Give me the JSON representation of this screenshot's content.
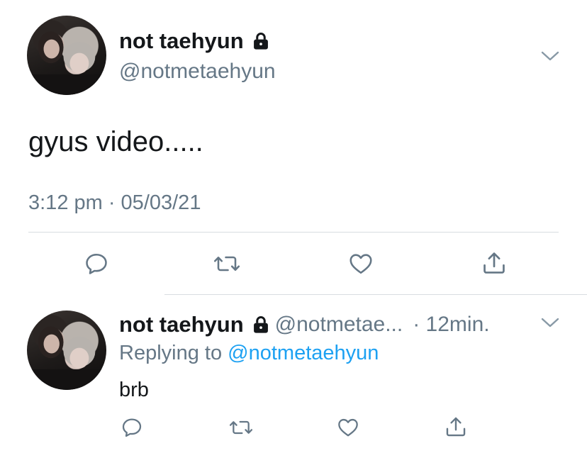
{
  "main_tweet": {
    "display_name": "not taehyun",
    "handle": "@notmetaehyun",
    "text": "gyus video.....",
    "timestamp": "3:12 pm · 05/03/21",
    "icons": [
      "lock-icon",
      "chevron-down-icon"
    ]
  },
  "main_actions": [
    "reply-icon",
    "retweet-icon",
    "like-icon",
    "share-icon"
  ],
  "reply_tweet": {
    "display_name": "not taehyun",
    "handle_truncated": "@notmetae...",
    "time_ago": "· 12min.",
    "replying_prefix": "Replying to",
    "replying_mention": "@notmetaehyun",
    "text": "brb"
  },
  "reply_actions": [
    "reply-icon",
    "retweet-icon",
    "like-icon",
    "share-icon"
  ],
  "colors": {
    "text_primary": "#14171a",
    "text_secondary": "#657786",
    "link": "#1da1f2",
    "icon": "#657786",
    "divider": "#d8dde1"
  }
}
